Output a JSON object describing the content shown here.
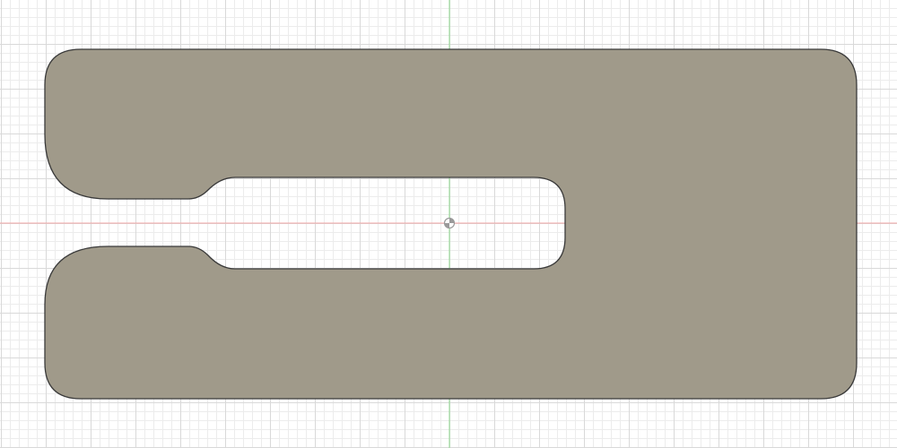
{
  "canvas": {
    "background": "#ffffff",
    "minor_grid_color": "#ececec",
    "major_grid_color": "#d9d9d9",
    "x_axis_color": "#f2a6a6",
    "y_axis_color": "#8fd98f"
  },
  "sketch_profile": {
    "kind": "slotted-plate",
    "fill_color": "#a09a8a",
    "edge_color": "#3a3a3a"
  },
  "origin_marker": {
    "icon": "origin-icon",
    "color": "#9a9a9a"
  }
}
